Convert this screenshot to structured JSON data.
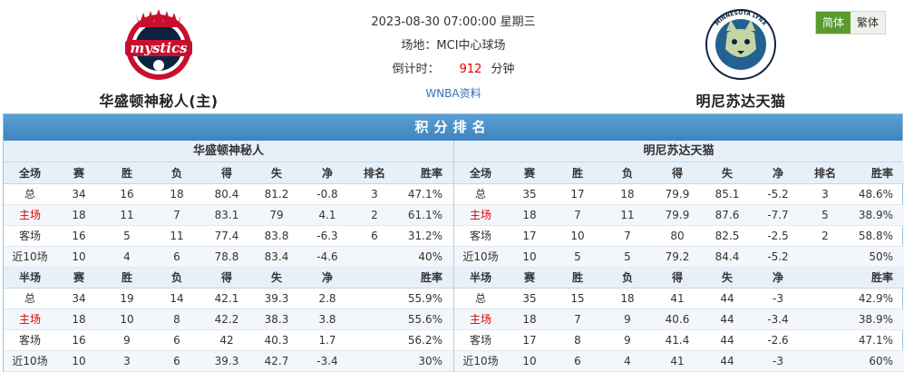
{
  "match": {
    "datetime": "2023-08-30 07:00:00 星期三",
    "venue": "场地：MCI中心球场",
    "countdown_label": "倒计时：",
    "countdown_value": "912",
    "countdown_unit": "分钟",
    "league_link": "WNBA资料"
  },
  "home_team": {
    "name": "华盛顿神秘人(主)",
    "logo_text": "mystics",
    "color": "#c8102e"
  },
  "away_team": {
    "name": "明尼苏达天猫",
    "logo_text": "MINNESOTA LYNX",
    "color": "#236192"
  },
  "lang": {
    "simplified": "简体",
    "traditional": "繁体"
  },
  "standings": {
    "title": "积分排名",
    "sides": [
      {
        "team": "华盛顿神秘人",
        "full": {
          "headers": [
            "全场",
            "赛",
            "胜",
            "负",
            "得",
            "失",
            "净",
            "排名",
            "胜率"
          ],
          "rows": [
            [
              "总",
              "34",
              "16",
              "18",
              "80.4",
              "81.2",
              "-0.8",
              "3",
              "47.1%"
            ],
            [
              "主场",
              "18",
              "11",
              "7",
              "83.1",
              "79",
              "4.1",
              "2",
              "61.1%"
            ],
            [
              "客场",
              "16",
              "5",
              "11",
              "77.4",
              "83.8",
              "-6.3",
              "6",
              "31.2%"
            ],
            [
              "近10场",
              "10",
              "4",
              "6",
              "78.8",
              "83.4",
              "-4.6",
              "",
              "40%"
            ]
          ]
        },
        "half": {
          "headers": [
            "半场",
            "赛",
            "胜",
            "负",
            "得",
            "失",
            "净",
            "",
            "胜率"
          ],
          "rows": [
            [
              "总",
              "34",
              "19",
              "14",
              "42.1",
              "39.3",
              "2.8",
              "",
              "55.9%"
            ],
            [
              "主场",
              "18",
              "10",
              "8",
              "42.2",
              "38.3",
              "3.8",
              "",
              "55.6%"
            ],
            [
              "客场",
              "16",
              "9",
              "6",
              "42",
              "40.3",
              "1.7",
              "",
              "56.2%"
            ],
            [
              "近10场",
              "10",
              "3",
              "6",
              "39.3",
              "42.7",
              "-3.4",
              "",
              "30%"
            ]
          ]
        }
      },
      {
        "team": "明尼苏达天猫",
        "full": {
          "headers": [
            "全场",
            "赛",
            "胜",
            "负",
            "得",
            "失",
            "净",
            "排名",
            "胜率"
          ],
          "rows": [
            [
              "总",
              "35",
              "17",
              "18",
              "79.9",
              "85.1",
              "-5.2",
              "3",
              "48.6%"
            ],
            [
              "主场",
              "18",
              "7",
              "11",
              "79.9",
              "87.6",
              "-7.7",
              "5",
              "38.9%"
            ],
            [
              "客场",
              "17",
              "10",
              "7",
              "80",
              "82.5",
              "-2.5",
              "2",
              "58.8%"
            ],
            [
              "近10场",
              "10",
              "5",
              "5",
              "79.2",
              "84.4",
              "-5.2",
              "",
              "50%"
            ]
          ]
        },
        "half": {
          "headers": [
            "半场",
            "赛",
            "胜",
            "负",
            "得",
            "失",
            "净",
            "",
            "胜率"
          ],
          "rows": [
            [
              "总",
              "35",
              "15",
              "18",
              "41",
              "44",
              "-3",
              "",
              "42.9%"
            ],
            [
              "主场",
              "18",
              "7",
              "9",
              "40.6",
              "44",
              "-3.4",
              "",
              "38.9%"
            ],
            [
              "客场",
              "17",
              "8",
              "9",
              "41.4",
              "44",
              "-2.6",
              "",
              "47.1%"
            ],
            [
              "近10场",
              "10",
              "6",
              "4",
              "41",
              "44",
              "-3",
              "",
              "60%"
            ]
          ]
        }
      }
    ]
  }
}
